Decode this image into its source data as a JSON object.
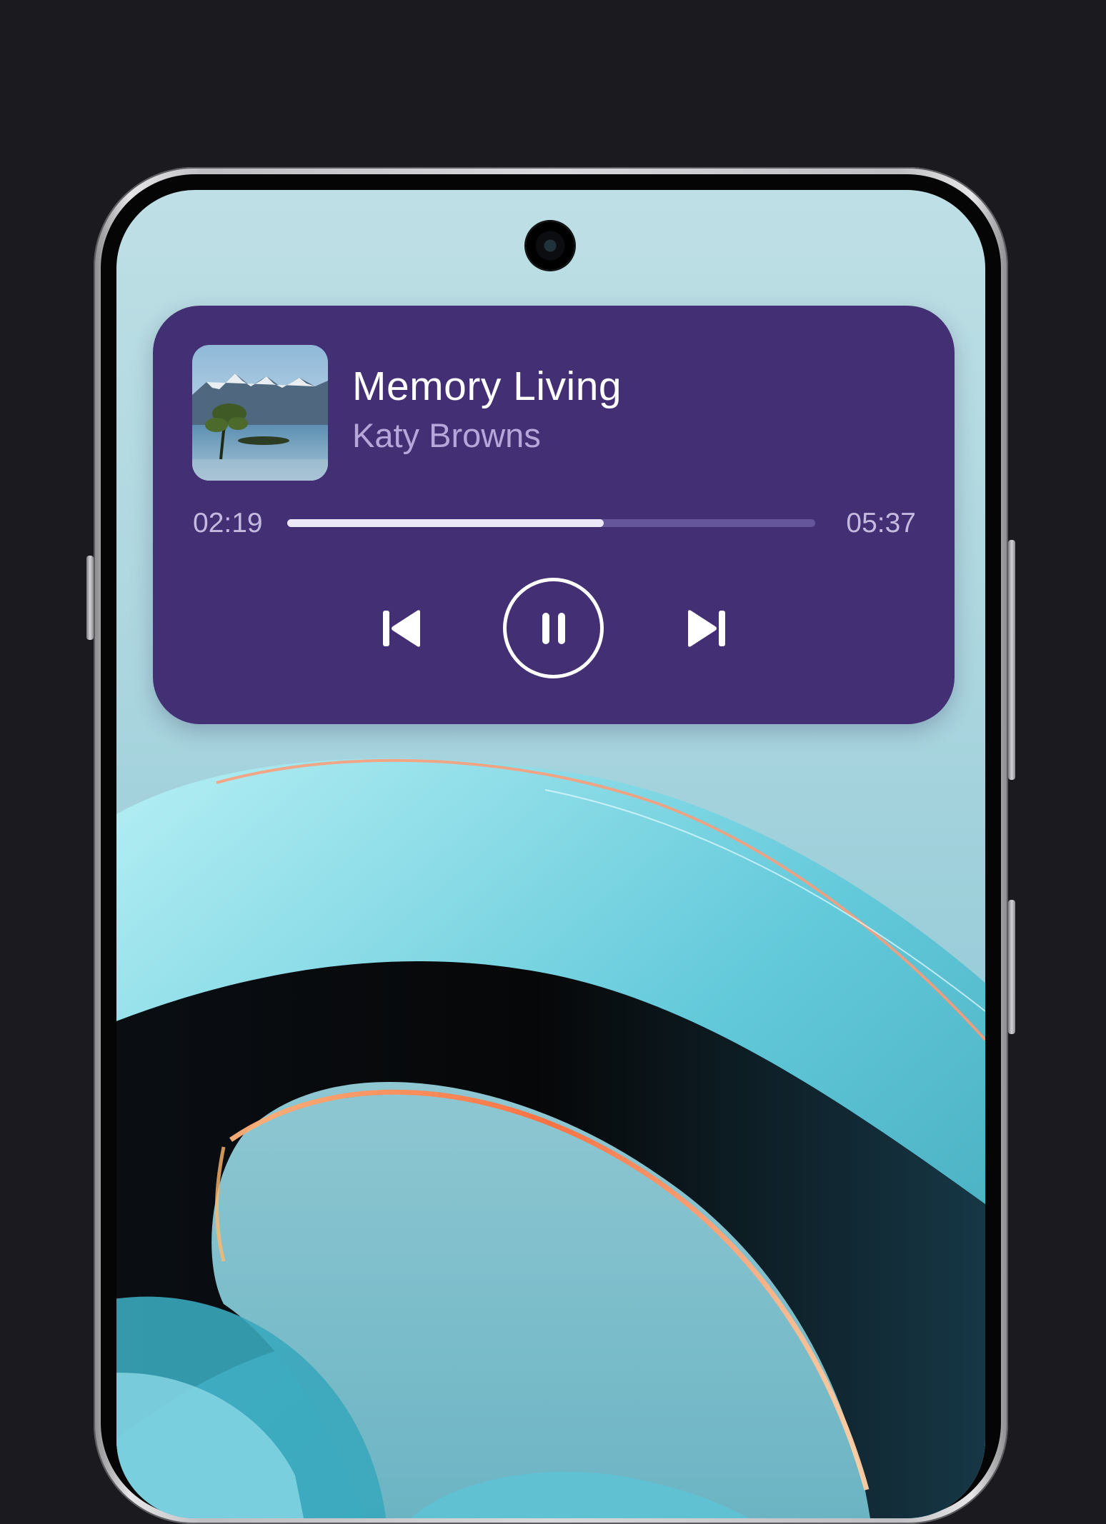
{
  "now_playing": {
    "title": "Memory Living",
    "artist": "Katy Browns",
    "elapsed": "02:19",
    "duration": "05:37",
    "progress": 0.6,
    "album_art": "lake-tree-mountains-photo",
    "state": "playing"
  },
  "controls": {
    "previous_icon": "skip-previous-icon",
    "play_pause_icon": "pause-icon",
    "next_icon": "skip-next-icon"
  },
  "colors": {
    "background": "#1b1b1f",
    "widget": "#432f73",
    "title": "#ffffff",
    "artist": "#b6a7da",
    "progress_fill": "#ece8f7",
    "progress_track": "#65559a"
  }
}
